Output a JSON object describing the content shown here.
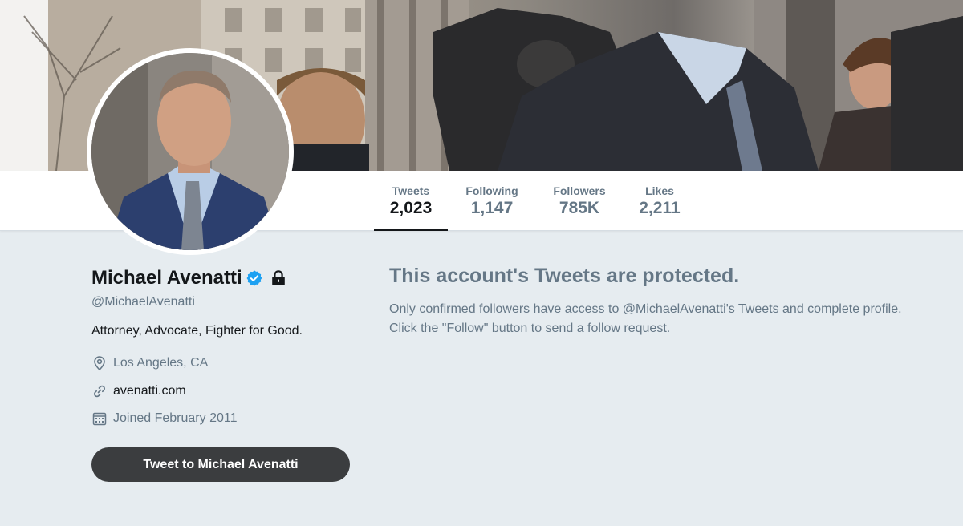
{
  "profile": {
    "name": "Michael Avenatti",
    "handle": "@MichaelAvenatti",
    "bio": "Attorney, Advocate, Fighter for Good.",
    "location": "Los Angeles, CA",
    "website": "avenatti.com",
    "joined": "Joined February 2011",
    "tweet_button_label": "Tweet to Michael Avenatti",
    "verified_icon": "verified-badge-icon",
    "lock_icon": "lock-icon"
  },
  "stats": [
    {
      "label": "Tweets",
      "value": "2,023",
      "active": true
    },
    {
      "label": "Following",
      "value": "1,147",
      "active": false
    },
    {
      "label": "Followers",
      "value": "785K",
      "active": false
    },
    {
      "label": "Likes",
      "value": "2,211",
      "active": false
    }
  ],
  "protected_notice": {
    "title": "This account's Tweets are protected.",
    "line1": "Only confirmed followers have access to @MichaelAvenatti's Tweets and complete profile.",
    "line2": "Click the \"Follow\" button to send a follow request."
  },
  "colors": {
    "background": "#e6ecf0",
    "text_primary": "#14171a",
    "text_secondary": "#657786",
    "verified_blue": "#1da1f2",
    "button_dark": "#3b3d3f"
  }
}
